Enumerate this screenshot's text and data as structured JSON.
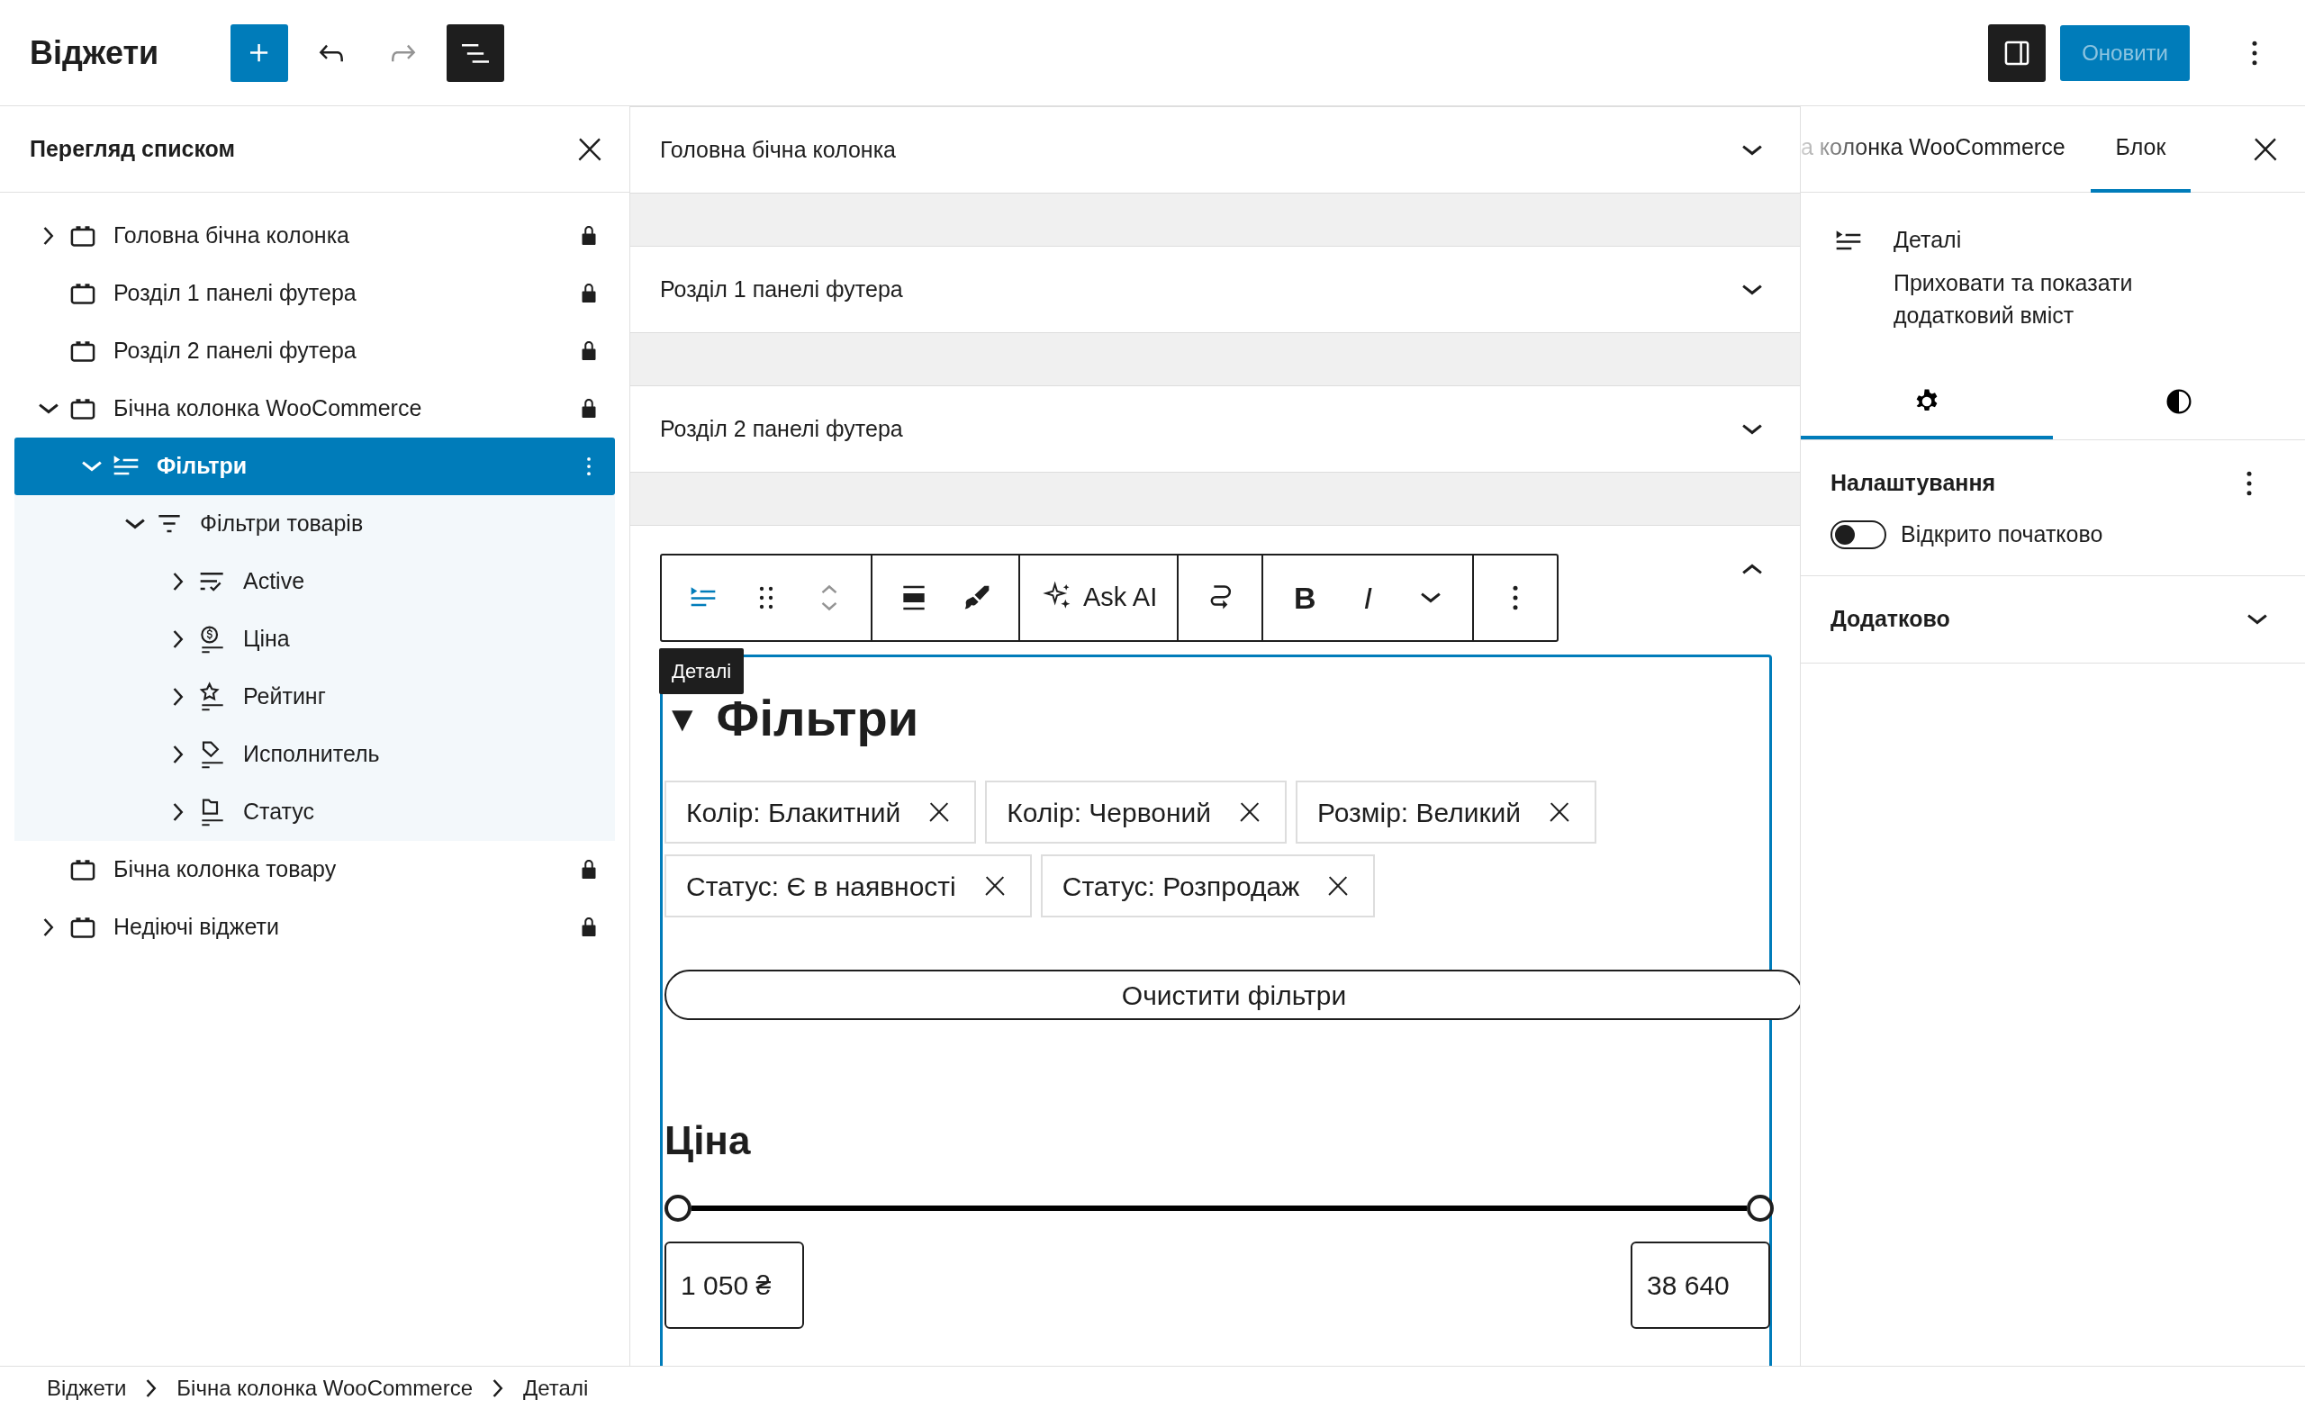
{
  "topbar": {
    "title": "Віджети",
    "update_button": {
      "label": "Оновити",
      "disabled": true
    },
    "list_view_open": true
  },
  "list_view": {
    "title": "Перегляд списком",
    "items": [
      {
        "label": "Головна бічна колонка",
        "kind": "area",
        "expandable": true,
        "expanded": false,
        "locked": true,
        "selected": false
      },
      {
        "label": "Розділ 1 панелі футера",
        "kind": "area",
        "expandable": false,
        "locked": true,
        "selected": false
      },
      {
        "label": "Розділ 2 панелі футера",
        "kind": "area",
        "expandable": false,
        "locked": true,
        "selected": false
      },
      {
        "label": "Бічна колонка WooCommerce",
        "kind": "area",
        "expandable": true,
        "expanded": true,
        "locked": true,
        "selected": false,
        "children": [
          {
            "label": "Фільтри",
            "kind": "details",
            "expandable": true,
            "expanded": true,
            "locked": false,
            "selected": true,
            "children": [
              {
                "label": "Фільтри товарів",
                "kind": "filters",
                "expandable": true,
                "expanded": true,
                "locked": false,
                "selected": false,
                "children": [
                  {
                    "label": "Active",
                    "kind": "active",
                    "expandable": true,
                    "expanded": false,
                    "locked": false,
                    "selected": false
                  },
                  {
                    "label": "Ціна",
                    "kind": "price",
                    "expandable": true,
                    "expanded": false,
                    "locked": false,
                    "selected": false
                  },
                  {
                    "label": "Рейтинг",
                    "kind": "rating",
                    "expandable": true,
                    "expanded": false,
                    "locked": false,
                    "selected": false
                  },
                  {
                    "label": "Исполнитель",
                    "kind": "attribute",
                    "expandable": true,
                    "expanded": false,
                    "locked": false,
                    "selected": false
                  },
                  {
                    "label": "Статус",
                    "kind": "status",
                    "expandable": true,
                    "expanded": false,
                    "locked": false,
                    "selected": false
                  }
                ]
              }
            ]
          }
        ]
      },
      {
        "label": "Бічна колонка товару",
        "kind": "area",
        "expandable": false,
        "locked": true,
        "selected": false
      },
      {
        "label": "Недіючі віджети",
        "kind": "area",
        "expandable": true,
        "expanded": false,
        "locked": true,
        "selected": false
      }
    ]
  },
  "editor": {
    "areas": [
      {
        "title": "Головна бічна колонка",
        "expanded": false
      },
      {
        "title": "Розділ 1 панелі футера",
        "expanded": false
      },
      {
        "title": "Розділ 2 панелі футера",
        "expanded": false
      },
      {
        "expanded": true,
        "block": {
          "toolbar": [
            [
              {
                "kind": "details",
                "highlighted": true
              },
              {
                "kind": "drag",
                "highlighted": false
              },
              {
                "kind": "mover",
                "highlighted": false
              }
            ],
            [
              {
                "kind": "align",
                "highlighted": false
              },
              {
                "kind": "brush",
                "highlighted": false
              }
            ],
            [
              {
                "kind": "ai",
                "label": "Ask AI",
                "highlighted": false
              }
            ],
            [
              {
                "kind": "transform",
                "highlighted": false
              }
            ],
            [
              {
                "kind": "bold",
                "label": "B",
                "highlighted": false
              },
              {
                "kind": "italic",
                "label": "I",
                "highlighted": false
              },
              {
                "kind": "more",
                "highlighted": false
              }
            ],
            [
              {
                "kind": "options",
                "highlighted": false
              }
            ]
          ],
          "tooltip": "Деталі",
          "summary_marker": "▼",
          "heading": "Фільтри",
          "chips": [
            "Колір: Блакитний",
            "Колір: Червоний",
            "Розмір: Великий",
            "Статус: Є в наявності",
            "Статус: Розпродаж"
          ],
          "clear_button": "Очистити фільтри",
          "price_heading": "Ціна",
          "slider_thumbs": [
            {
              "level": 0
            },
            {
              "level": 1
            }
          ],
          "min_value": "1 050 ₴",
          "max_value": "38 640"
        }
      }
    ]
  },
  "sidebar": {
    "tabs": [
      {
        "label": "а колонка WooCommerce",
        "selected": false
      },
      {
        "label": "Блок",
        "selected": true
      }
    ],
    "block_card": {
      "title": "Деталі",
      "description": "Приховати та показати додатковий вміст"
    },
    "subtabs": [
      {
        "kind": "settings",
        "selected": true
      },
      {
        "kind": "styles",
        "selected": false
      }
    ],
    "panels": [
      {
        "title": "Налаштування",
        "open": true,
        "toggle": {
          "label": "Відкрито початково",
          "on": false
        }
      },
      {
        "title": "Додатково",
        "open": false
      }
    ]
  },
  "breadcrumbs": [
    "Віджети",
    "Бічна колонка WooCommerce",
    "Деталі"
  ]
}
